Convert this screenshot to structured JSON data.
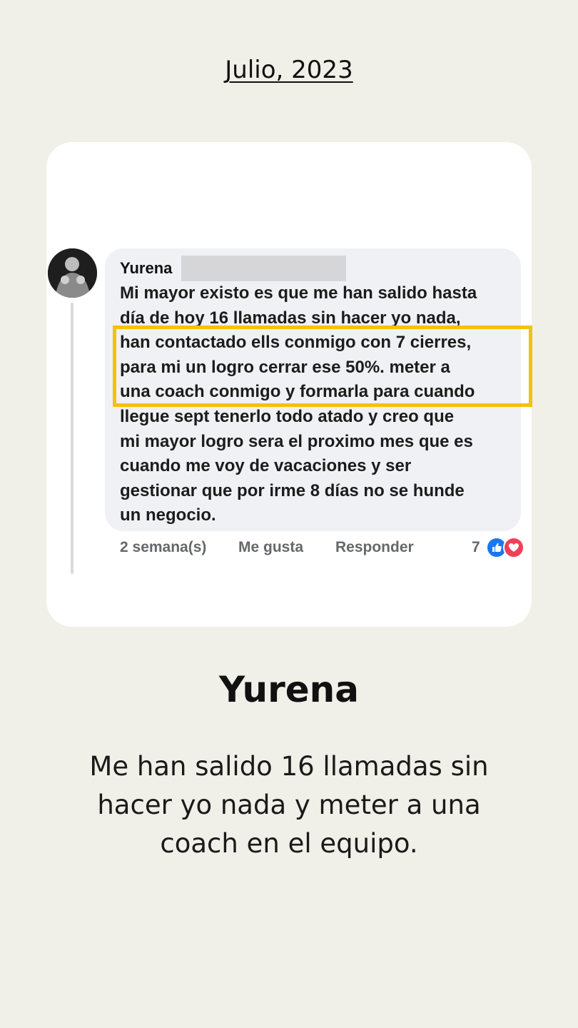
{
  "header": {
    "date_label": "Julio, 2023"
  },
  "comment": {
    "author": "Yurena",
    "body_lines": [
      "Mi mayor existo es que me han salido hasta",
      "día de hoy 16 llamadas sin hacer yo nada,",
      "han contactado ells conmigo con 7 cierres,",
      "para mi un logro cerrar ese 50%.  meter a",
      "una coach conmigo y formarla para cuando",
      "llegue sept tenerlo todo atado y creo que",
      "mi mayor logro sera el proximo mes que es",
      "cuando me voy de vacaciones y ser",
      "gestionar que por irme 8 días no se hunde",
      "un negocio."
    ],
    "timestamp": "2 semana(s)",
    "like_label": "Me gusta",
    "reply_label": "Responder",
    "reaction_count": "7",
    "reaction_icons": [
      "like-icon",
      "love-icon"
    ]
  },
  "testimonial": {
    "name": "Yurena",
    "quote": "Me han salido 16 llamadas sin hacer yo nada y meter a una coach en el equipo."
  },
  "colors": {
    "background": "#f0efe8",
    "highlight": "#f5c10a",
    "like": "#1877f2",
    "love": "#f33e58"
  }
}
